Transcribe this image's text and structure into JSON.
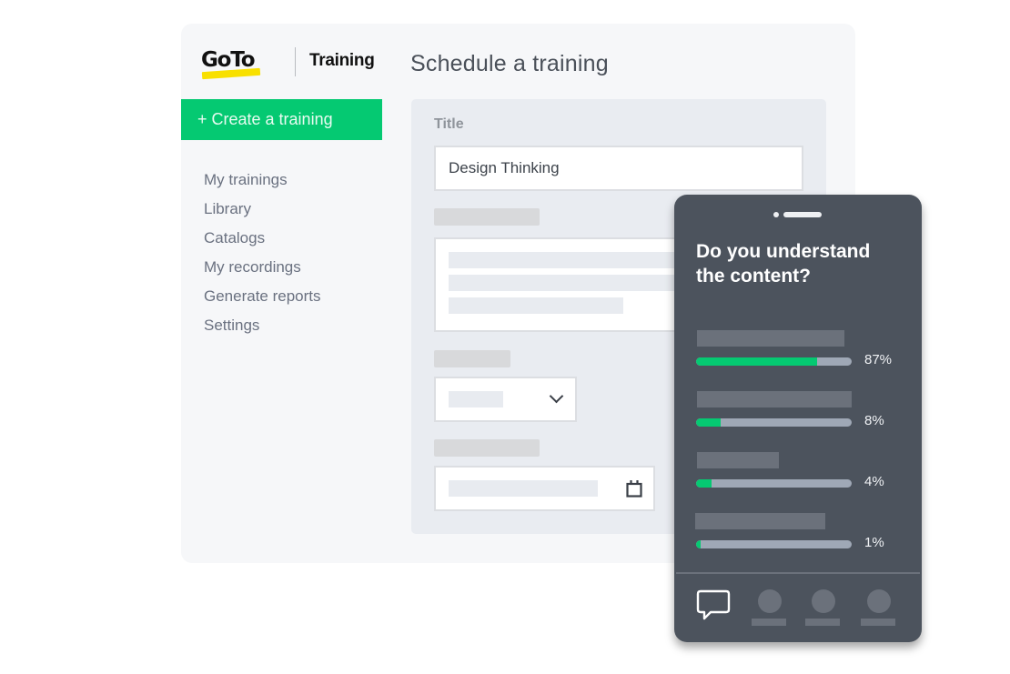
{
  "brand": {
    "logo_text": "GoTo",
    "product_name": "Training",
    "accent_color": "#05c972",
    "logo_underline_color": "#f8e000"
  },
  "sidebar": {
    "create_button_label": "+ Create a training",
    "items": [
      {
        "label": "My trainings"
      },
      {
        "label": "Library"
      },
      {
        "label": "Catalogs"
      },
      {
        "label": "My recordings"
      },
      {
        "label": "Generate reports"
      },
      {
        "label": "Settings"
      }
    ]
  },
  "main": {
    "page_title": "Schedule a training",
    "form": {
      "title_label": "Title",
      "title_value": "Design Thinking",
      "select_icon": "chevron-down-icon",
      "date_icon": "calendar-icon"
    }
  },
  "poll": {
    "question": "Do you understand the content?",
    "options": [
      {
        "percent_label": "87%",
        "fill_fraction": 0.78
      },
      {
        "percent_label": "8%",
        "fill_fraction": 0.16
      },
      {
        "percent_label": "4%",
        "fill_fraction": 0.1
      },
      {
        "percent_label": "1%",
        "fill_fraction": 0.03
      }
    ],
    "tabs": [
      {
        "icon": "chat-bubble-icon",
        "active": true
      },
      {
        "icon": "person-icon"
      },
      {
        "icon": "person-icon"
      },
      {
        "icon": "person-icon"
      }
    ]
  }
}
